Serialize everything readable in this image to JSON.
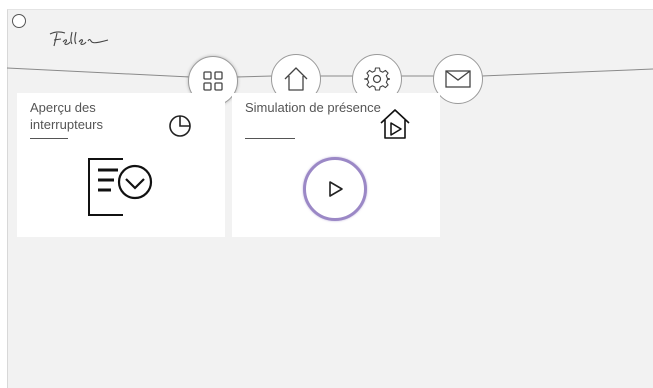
{
  "header": {
    "logo_text": "Feller"
  },
  "nav": {
    "items": [
      {
        "name": "dashboard",
        "icon": "grid-icon"
      },
      {
        "name": "home",
        "icon": "house-icon"
      },
      {
        "name": "settings",
        "icon": "gear-icon"
      },
      {
        "name": "messages",
        "icon": "mail-icon"
      }
    ]
  },
  "tiles": [
    {
      "label": "Aperçu des interrupteurs",
      "corner_icon": "pie-chart-icon",
      "main_icon": "list-clock-icon"
    },
    {
      "label": "Simulation de présence",
      "corner_icon": "house-play-icon",
      "main_icon": "play-button-icon"
    }
  ],
  "colors": {
    "background": "#f2f2f2",
    "tile": "#ffffff",
    "accent_ring": "#9b88c6",
    "text": "#555555"
  }
}
